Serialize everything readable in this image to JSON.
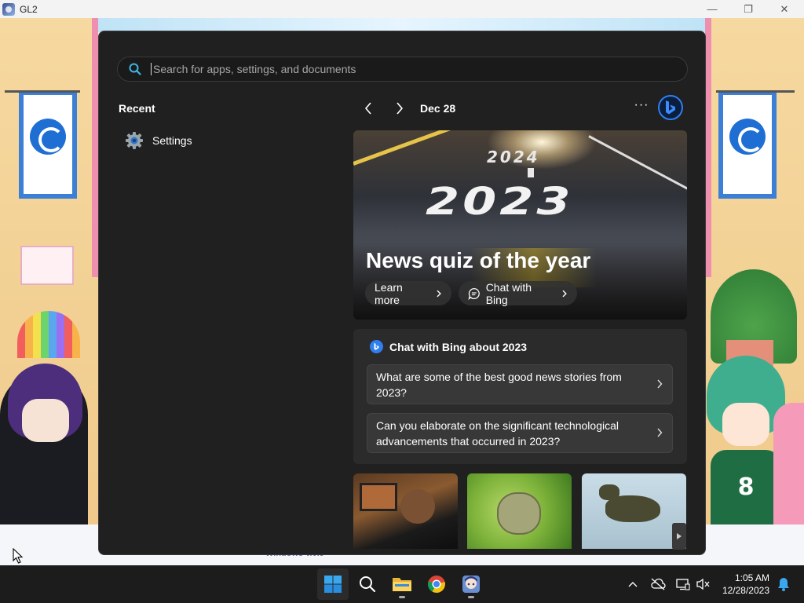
{
  "app_window": {
    "title": "GL2",
    "footer_text": "Windows v.0.9",
    "controls": {
      "minimize": "—",
      "maximize": "❐",
      "close": "✕"
    }
  },
  "start_menu": {
    "search": {
      "placeholder": "Search for apps, settings, and documents",
      "value": ""
    },
    "recent": {
      "heading": "Recent",
      "items": [
        {
          "label": "Settings",
          "icon": "gear-icon"
        }
      ]
    },
    "feed": {
      "date": "Dec 28",
      "more_label": "···",
      "hero": {
        "year_small": "2024",
        "year_big": "2023",
        "title": "News quiz of the year",
        "learn_more": "Learn more",
        "chat_with_bing": "Chat with Bing"
      },
      "chat_card": {
        "title": "Chat with Bing about 2023",
        "questions": [
          "What are some of the best good news stories from 2023?",
          "Can you elaborate on the significant technological advancements that occurred in 2023?"
        ]
      },
      "thumbnails": [
        "gamer-image",
        "frog-image",
        "dinosaur-image"
      ]
    }
  },
  "taskbar": {
    "apps": [
      "start-icon",
      "search-icon",
      "file-explorer-icon",
      "chrome-icon",
      "gl2-app-icon"
    ],
    "clock": {
      "time": "1:05 AM",
      "date": "12/28/2023"
    }
  },
  "colors": {
    "accent": "#2f7ff0",
    "menu_bg": "#202020",
    "card_bg": "#2b2b2b",
    "taskbar_bg": "#1c1c1c"
  }
}
